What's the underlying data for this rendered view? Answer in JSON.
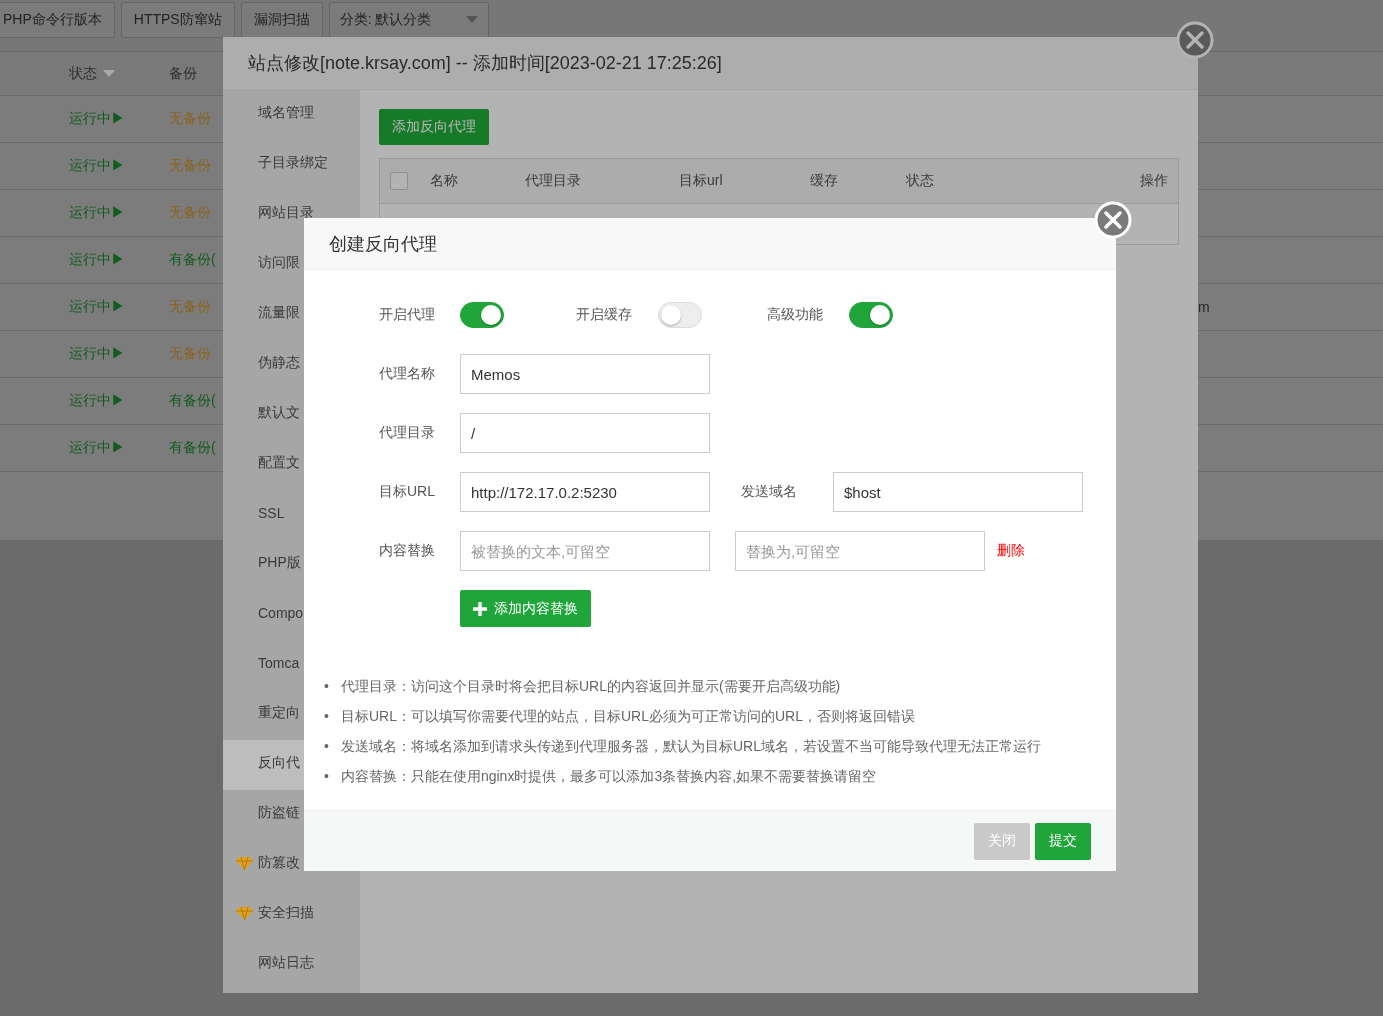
{
  "toolbar": {
    "buttons": [
      "PHP命令行版本",
      "HTTPS防窜站",
      "漏洞扫描"
    ],
    "category_dropdown": {
      "value": "分类: 默认分类"
    }
  },
  "site_table": {
    "columns": [
      "状态",
      "备份"
    ],
    "rows": [
      {
        "status": "运行中▶",
        "backup": "无备份",
        "has_backup": false
      },
      {
        "status": "运行中▶",
        "backup": "无备份",
        "has_backup": false
      },
      {
        "status": "运行中▶",
        "backup": "无备份",
        "has_backup": false
      },
      {
        "status": "运行中▶",
        "backup": "有备份(",
        "has_backup": true
      },
      {
        "status": "运行中▶",
        "backup": "无备份",
        "has_backup": false,
        "column_3": "m"
      },
      {
        "status": "运行中▶",
        "backup": "无备份",
        "has_backup": false
      },
      {
        "status": "运行中▶",
        "backup": "有备份(",
        "has_backup": true
      },
      {
        "status": "运行中▶",
        "backup": "有备份(",
        "has_backup": true
      }
    ]
  },
  "site_dialog": {
    "title": "站点修改[note.krsay.com] -- 添加时间[2023-02-21 17:25:26]",
    "sidebar": {
      "items": [
        {
          "label": "域名管理",
          "selected": false,
          "kind": "plain"
        },
        {
          "label": "子目录绑定",
          "selected": false,
          "kind": "plain"
        },
        {
          "label": "网站目录",
          "selected": false,
          "kind": "plain"
        },
        {
          "label": "访问限",
          "selected": false,
          "kind": "plain"
        },
        {
          "label": "流量限",
          "selected": false,
          "kind": "plain"
        },
        {
          "label": "伪静态",
          "selected": false,
          "kind": "plain"
        },
        {
          "label": "默认文",
          "selected": false,
          "kind": "plain"
        },
        {
          "label": "配置文",
          "selected": false,
          "kind": "plain"
        },
        {
          "label": "SSL",
          "selected": false,
          "kind": "plain"
        },
        {
          "label": "PHP版",
          "selected": false,
          "kind": "plain"
        },
        {
          "label": "Compo",
          "selected": false,
          "kind": "plain"
        },
        {
          "label": "Tomca",
          "selected": false,
          "kind": "plain"
        },
        {
          "label": "重定向",
          "selected": false,
          "kind": "plain"
        },
        {
          "label": "反向代",
          "selected": true,
          "kind": "plain"
        },
        {
          "label": "防盗链",
          "selected": false,
          "kind": "plain"
        },
        {
          "label": "防篡改",
          "selected": false,
          "kind": "premium"
        },
        {
          "label": "安全扫描",
          "selected": false,
          "kind": "premium"
        },
        {
          "label": "网站日志",
          "selected": false,
          "kind": "plain"
        }
      ]
    },
    "add_button": "添加反向代理",
    "proxy_table": {
      "select_all_checked": false,
      "columns": [
        "名称",
        "代理目录",
        "目标url",
        "缓存",
        "状态",
        "操作"
      ]
    }
  },
  "proxy_dialog": {
    "title": "创建反向代理",
    "toggles": [
      {
        "label": "开启代理",
        "on": true
      },
      {
        "label": "开启缓存",
        "on": false
      },
      {
        "label": "高级功能",
        "on": true
      }
    ],
    "proxy_name": {
      "label": "代理名称",
      "value": "Memos"
    },
    "proxy_dir": {
      "label": "代理目录",
      "value": "/"
    },
    "target_url": {
      "label": "目标URL",
      "value": "http://172.17.0.2:5230"
    },
    "send_domain": {
      "label": "发送域名",
      "value": "$host"
    },
    "content_replace": {
      "label": "内容替换",
      "from_placeholder": "被替换的文本,可留空",
      "to_placeholder": "替换为,可留空",
      "delete_link": "删除"
    },
    "add_replace_button": "添加内容替换",
    "notes": [
      {
        "bullet": "•",
        "text": "代理目录：访问这个目录时将会把目标URL的内容返回并显示(需要开启高级功能)"
      },
      {
        "bullet": "•",
        "text": "目标URL：可以填写你需要代理的站点，目标URL必须为可正常访问的URL，否则将返回错误"
      },
      {
        "bullet": "•",
        "text": "发送域名：将域名添加到请求头传递到代理服务器，默认为目标URL域名，若设置不当可能导致代理无法正常运行"
      },
      {
        "bullet": "•",
        "text": "内容替换：只能在使用nginx时提供，最多可以添加3条替换内容,如果不需要替换请留空"
      }
    ],
    "buttons": {
      "close": "关闭",
      "submit": "提交"
    }
  }
}
